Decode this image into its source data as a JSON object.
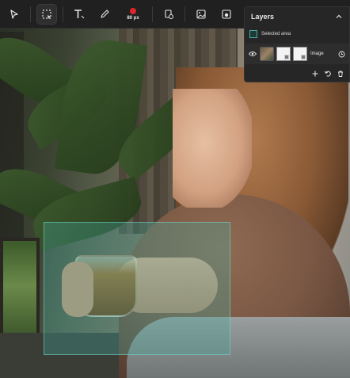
{
  "toolbar": {
    "brush_size_label": "80 px",
    "brush_color": "#e0242c"
  },
  "layers_panel": {
    "title": "Layers",
    "selected_area_label": "Selected area",
    "layers": [
      {
        "name": "Image"
      }
    ]
  },
  "colors": {
    "selection_fill": "#42aaa0",
    "panel_bg": "#262626",
    "toolbar_bg": "#202020"
  }
}
